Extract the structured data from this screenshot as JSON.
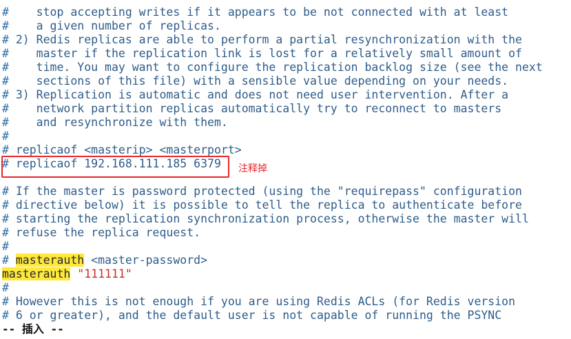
{
  "editor": {
    "lines": [
      {
        "hash": "#",
        "text": "    stop accepting writes if it appears to be not connected with at least"
      },
      {
        "hash": "#",
        "text": "    a given number of replicas."
      },
      {
        "hash": "#",
        "text": " 2) Redis replicas are able to perform a partial resynchronization with the"
      },
      {
        "hash": "#",
        "text": "    master if the replication link is lost for a relatively small amount of"
      },
      {
        "hash": "#",
        "text": "    time. You may want to configure the replication backlog size (see the next"
      },
      {
        "hash": "#",
        "text": "    sections of this file) with a sensible value depending on your needs."
      },
      {
        "hash": "#",
        "text": " 3) Replication is automatic and does not need user intervention. After a"
      },
      {
        "hash": "#",
        "text": "    network partition replicas automatically try to reconnect to masters"
      },
      {
        "hash": "#",
        "text": "    and resynchronize with them."
      },
      {
        "hash": "#",
        "text": ""
      },
      {
        "hash": "#",
        "text": " replicaof <masterip> <masterport>"
      },
      {
        "hash": "#",
        "text": " replicaof 192.168.111.185 6379"
      },
      {
        "hash": "",
        "text": ""
      },
      {
        "hash": "#",
        "text": " If the master is password protected (using the \"requirepass\" configuration"
      },
      {
        "hash": "#",
        "text": " directive below) it is possible to tell the replica to authenticate before"
      },
      {
        "hash": "#",
        "text": " starting the replication synchronization process, otherwise the master will"
      },
      {
        "hash": "#",
        "text": " refuse the replica request."
      },
      {
        "hash": "#",
        "text": ""
      }
    ],
    "masterauth_comment": {
      "hash": "#",
      "pre": " ",
      "keyword": "masterauth",
      "rest": " <master-password>"
    },
    "masterauth_setting": {
      "keyword": "masterauth",
      "value": " \"111111\""
    },
    "tail_lines": [
      {
        "hash": "#",
        "text": ""
      },
      {
        "hash": "#",
        "text": " However this is not enough if you are using Redis ACLs (for Redis version"
      },
      {
        "hash": "#",
        "text": " 6 or greater), and the default user is not capable of running the PSYNC"
      }
    ]
  },
  "annotation": {
    "label": "注释掉",
    "color": "#e8262a"
  },
  "status": {
    "mode": "-- 插入 --"
  },
  "colors": {
    "comment": "#2e5c8a",
    "highlight": "#ffe83a",
    "string": "#cc2b2b"
  }
}
